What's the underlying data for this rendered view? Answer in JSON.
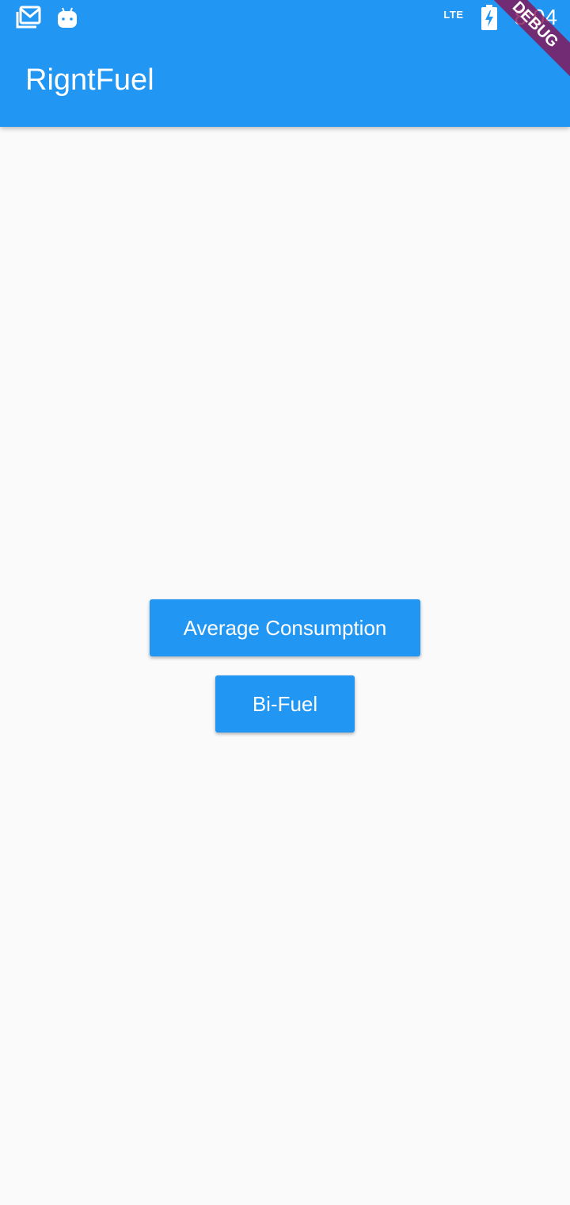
{
  "status_bar": {
    "network": "LTE",
    "time": "8:04",
    "icons": [
      "mail-icon",
      "android-icon",
      "battery-charging-icon"
    ]
  },
  "app_bar": {
    "title": "RigntFuel"
  },
  "debug_banner": "DEBUG",
  "main": {
    "buttons": [
      {
        "label": "Average Consumption"
      },
      {
        "label": "Bi-Fuel"
      }
    ]
  },
  "colors": {
    "primary": "#2196f3",
    "background": "#fafafa",
    "debug_ribbon": "#880e4f"
  }
}
